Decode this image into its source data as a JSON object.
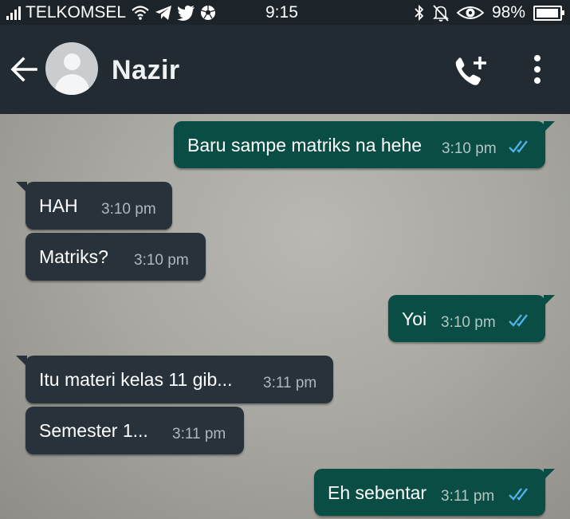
{
  "status_bar": {
    "carrier": "TELKOMSEL",
    "time": "9:15",
    "battery": "98%",
    "left_icons": [
      "signal-icon",
      "wifi-icon",
      "telegram-icon",
      "twitter-icon",
      "soccer-ball-icon"
    ],
    "right_icons": [
      "bluetooth-icon",
      "bell-muted-icon",
      "eye-icon",
      "battery-icon"
    ]
  },
  "header": {
    "contact_name": "Nazir",
    "icons": [
      "back-arrow-icon",
      "avatar-icon",
      "add-call-icon",
      "more-vertical-icon"
    ]
  },
  "messages": [
    {
      "direction": "out",
      "text": "Baru sampe matriks na hehe",
      "time": "3:10 pm",
      "read": true
    },
    {
      "direction": "in",
      "text": "HAH",
      "time": "3:10 pm"
    },
    {
      "direction": "in",
      "text": "Matriks?",
      "time": "3:10 pm"
    },
    {
      "direction": "out",
      "text": "Yoi",
      "time": "3:10 pm",
      "read": true
    },
    {
      "direction": "in",
      "text": "Itu materi kelas 11 gib...",
      "time": "3:11 pm"
    },
    {
      "direction": "in",
      "text": "Semester 1...",
      "time": "3:11 pm"
    },
    {
      "direction": "out",
      "text": "Eh sebentar",
      "time": "3:11 pm",
      "read": true
    }
  ],
  "colors": {
    "status_bar_bg": "#1c2329",
    "app_bar_bg": "#222b31",
    "incoming_bubble": "#27323a",
    "outgoing_bubble": "#0a4d45",
    "read_tick": "#4fb3e8"
  }
}
